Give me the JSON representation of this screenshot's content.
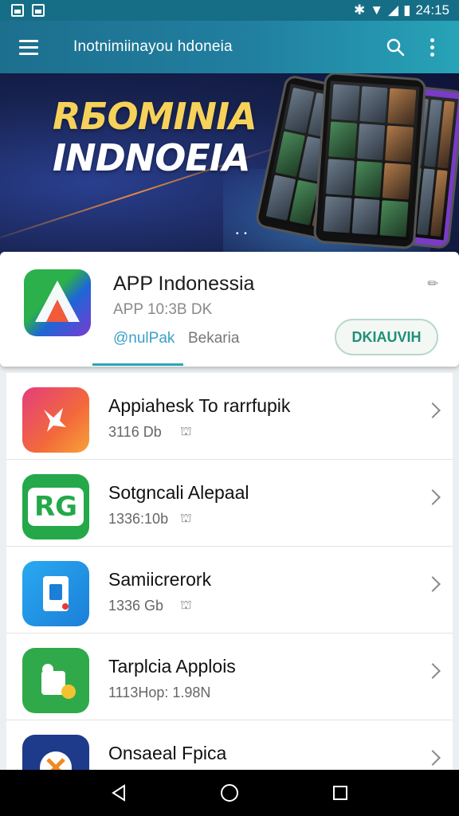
{
  "status_bar": {
    "time": "24:15"
  },
  "app_bar": {
    "title": "Inotnimiinayou hdoneia"
  },
  "banner": {
    "line1": "RБOMINIA",
    "line2": "INDNOEIA",
    "dots": "• •"
  },
  "featured": {
    "name": "APP Indonessia",
    "meta": "APP 10:3B DK",
    "developer": "@nulPak",
    "category": "Bekaria",
    "download_label": "DKIAUVIH"
  },
  "apps": [
    {
      "name": "Appiahesk To rarrfupik",
      "meta": "3116 Db",
      "icon": "shopping-icon"
    },
    {
      "name": "Sotgncali Alepaal",
      "meta": "1336:10b",
      "icon": "rg-logo-icon",
      "icon_text": "RG"
    },
    {
      "name": "Samiicrerork",
      "meta": "1336 Gb",
      "icon": "document-icon"
    },
    {
      "name": "Tarplcia Applois",
      "meta": "1113Hор: 1.98N",
      "icon": "puzzle-icon"
    },
    {
      "name": "Onsaeal Fpica",
      "meta": "",
      "icon": "cross-icon"
    }
  ],
  "colors": {
    "primary": "#1d6f8e",
    "accent": "#2ea3b8",
    "download": "#1f8f77"
  }
}
